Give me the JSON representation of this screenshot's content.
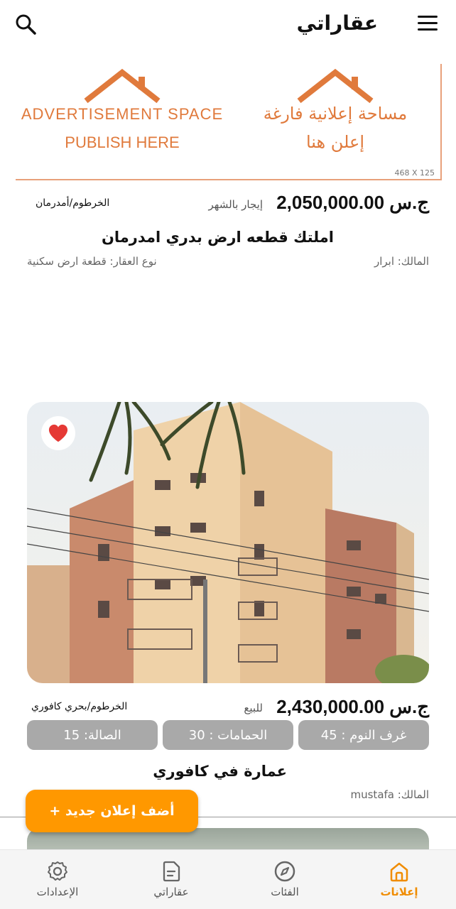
{
  "app": {
    "title": "عقاراتي"
  },
  "ad": {
    "en_line1": "ADVERTISEMENT SPACE",
    "en_line2": "PUBLISH HERE",
    "ar_line1": "مساحة إعلانية فارغة",
    "ar_line2": "إعلن هنا",
    "size": "468 X 125",
    "accent": "#e07a3c"
  },
  "listing1": {
    "price": "ج.س 2,050,000.00",
    "type": "إيجار بالشهر",
    "location": "الخرطوم/أمدرمان",
    "title": "املتك قطعه  ارض بدري امدرمان",
    "owner": "المالك: ابرار",
    "property_type": "نوع العقار: قطعة ارض سكنية"
  },
  "listing2": {
    "favorited": true,
    "price": "ج.س 2,430,000.00",
    "type": "للبيع",
    "location": "الخرطوم/بحري كافوري",
    "chips": [
      "غرف النوم : 45",
      "الحمامات : 30",
      "الصالة: 15"
    ],
    "title": "عمارة في كافوري",
    "owner": "المالك: mustafa"
  },
  "fab": {
    "label": "أضف إعلان جديد +"
  },
  "bottom_nav": [
    {
      "label": "إعلانات",
      "icon": "home-icon",
      "active": true
    },
    {
      "label": "الفئات",
      "icon": "compass-icon",
      "active": false
    },
    {
      "label": "عقاراتي",
      "icon": "document-icon",
      "active": false
    },
    {
      "label": "الإعدادات",
      "icon": "gear-icon",
      "active": false
    }
  ],
  "colors": {
    "accent": "#ff9800",
    "active_nav": "#f08c00",
    "chip": "#a9a9a9",
    "heart": "#e53935"
  }
}
